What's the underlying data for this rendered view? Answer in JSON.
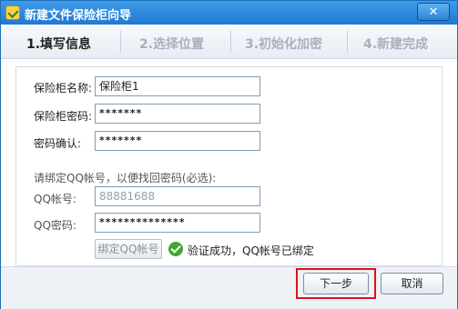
{
  "window": {
    "title": "新建文件保险柜向导",
    "close_symbol": "✕"
  },
  "steps": [
    {
      "label": "1.填写信息",
      "active": true
    },
    {
      "label": "2.选择位置",
      "active": false
    },
    {
      "label": "3.初始化加密",
      "active": false
    },
    {
      "label": "4.新建完成",
      "active": false
    }
  ],
  "form": {
    "name_label": "保险柜名称:",
    "name_value": "保险柜1",
    "password_label": "保险柜密码:",
    "password_value": "*******",
    "confirm_label": "密码确认:",
    "confirm_value": "*******",
    "bind_prompt": "请绑定QQ帐号，以便找回密码(必选):",
    "qq_label": "QQ帐号:",
    "qq_placeholder": "88881688",
    "qq_pw_label": "QQ密码:",
    "qq_pw_value": "**************",
    "bind_button": "绑定QQ帐号",
    "verify_text": "验证成功，QQ帐号已绑定"
  },
  "footer": {
    "next": "下一步",
    "cancel": "取消"
  },
  "colors": {
    "titlebar": "#2a86db",
    "highlight": "#e0101a",
    "success": "#43a72f"
  }
}
